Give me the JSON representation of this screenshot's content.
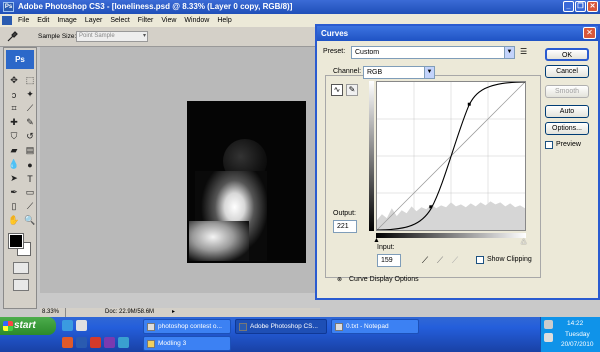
{
  "photoshop": {
    "title": "Adobe Photoshop CS3 - [loneliness.psd @ 8.33% (Layer 0 copy, RGB/8)]",
    "menus": [
      "File",
      "Edit",
      "Image",
      "Layer",
      "Select",
      "Filter",
      "View",
      "Window",
      "Help"
    ],
    "options_bar": {
      "sample_size_label": "Sample Size:",
      "sample_size_value": "Point Sample"
    },
    "tools_logo": "Ps",
    "status": {
      "zoom": "8.33%",
      "doc_info": "Doc: 22.9M/58.6M"
    }
  },
  "curves": {
    "title": "Curves",
    "preset_label": "Preset:",
    "preset_value": "Custom",
    "channel_label": "Channel:",
    "channel_value": "RGB",
    "output_label": "Output:",
    "output_value": "221",
    "input_label": "Input:",
    "input_value": "159",
    "show_clipping_label": "Show Clipping",
    "curve_display_options": "Curve Display Options",
    "buttons": {
      "ok": "OK",
      "cancel": "Cancel",
      "smooth": "Smooth",
      "auto": "Auto",
      "options": "Options..."
    },
    "preview_label": "Preview"
  },
  "taskbar": {
    "start_label": "start",
    "tasks": [
      {
        "label": "photoshop contest o..."
      },
      {
        "label": "Adobe Photoshop CS..."
      },
      {
        "label": "0.txt - Notepad"
      },
      {
        "label": "Modling 3"
      }
    ],
    "clock": "14:22",
    "day": "Tuesday",
    "date": "20/07/2010"
  }
}
